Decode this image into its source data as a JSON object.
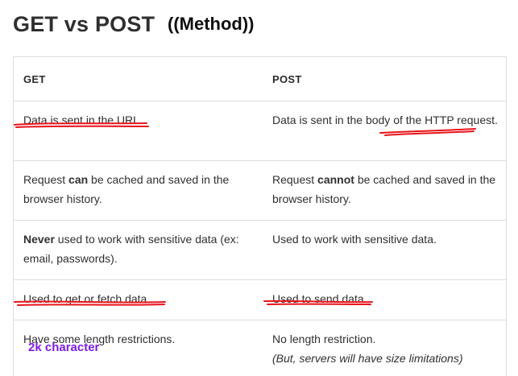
{
  "title": "GET vs POST",
  "handwritten_note": "((Method))",
  "table": {
    "headers": [
      "GET",
      "POST"
    ],
    "rows": [
      {
        "get": {
          "text": "Data is sent in the URL."
        },
        "post": {
          "text": "Data is sent in the body of the HTTP request."
        }
      },
      {
        "get": {
          "before": "Request ",
          "bold": "can",
          "after": " be cached and saved in the browser history."
        },
        "post": {
          "before": "Request ",
          "bold": "cannot",
          "after": " be cached and saved in the browser history."
        }
      },
      {
        "get": {
          "before": "",
          "bold": "Never",
          "after": " used to work with sensitive data (ex: email, passwords)."
        },
        "post": {
          "text": "Used to work with sensitive data."
        }
      },
      {
        "get": {
          "text": "Used to get or fetch data."
        },
        "post": {
          "text": "Used to send data."
        }
      },
      {
        "get": {
          "text": "Have some length restrictions."
        },
        "post": {
          "text": "No length restriction.",
          "italic_note": "(But, servers will have size limitations)"
        }
      }
    ]
  },
  "annotation_2k": "2k character",
  "colors": {
    "underline_ink": "#e8141a",
    "note_purple": "#7b1de2",
    "border": "#dddddd"
  }
}
